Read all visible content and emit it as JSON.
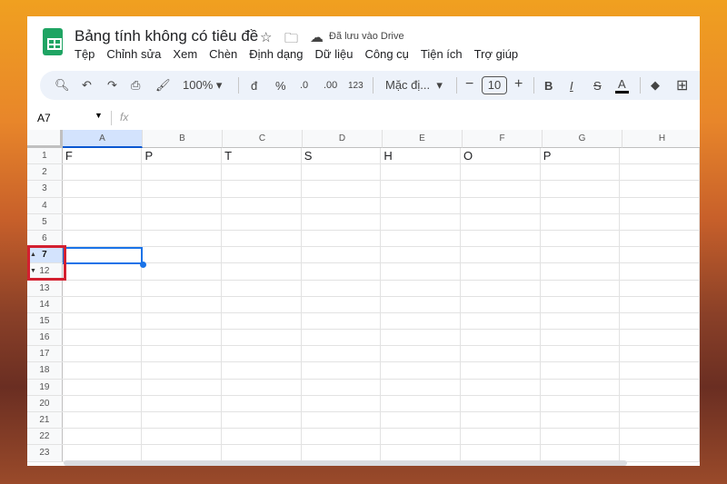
{
  "title": "Bảng tính không có tiêu đề",
  "save_status": "Đã lưu vào Drive",
  "menu": [
    "Tệp",
    "Chỉnh sửa",
    "Xem",
    "Chèn",
    "Định dạng",
    "Dữ liệu",
    "Công cụ",
    "Tiện ích",
    "Trợ giúp"
  ],
  "toolbar": {
    "zoom": "100%",
    "currency": "đ",
    "percent": "%",
    "dec_decrease": ".0",
    "dec_increase": ".00",
    "number_format": "123",
    "font": "Mặc đị...",
    "font_size": "10",
    "bold": "B",
    "italic": "I",
    "text_color": "A"
  },
  "name_box": "A7",
  "fx": "fx",
  "columns": [
    "A",
    "B",
    "C",
    "D",
    "E",
    "F",
    "G",
    "H"
  ],
  "rows": [
    {
      "n": "1",
      "cells": [
        "F",
        "P",
        "T",
        "S",
        "H",
        "O",
        "P",
        ""
      ]
    },
    {
      "n": "2",
      "cells": []
    },
    {
      "n": "3",
      "cells": []
    },
    {
      "n": "4",
      "cells": []
    },
    {
      "n": "5",
      "cells": []
    },
    {
      "n": "6",
      "cells": []
    },
    {
      "n": "7",
      "cells": []
    },
    {
      "n": "12",
      "cells": []
    },
    {
      "n": "13",
      "cells": []
    },
    {
      "n": "14",
      "cells": []
    },
    {
      "n": "15",
      "cells": []
    },
    {
      "n": "16",
      "cells": []
    },
    {
      "n": "17",
      "cells": []
    },
    {
      "n": "18",
      "cells": []
    },
    {
      "n": "19",
      "cells": []
    },
    {
      "n": "20",
      "cells": []
    },
    {
      "n": "21",
      "cells": []
    },
    {
      "n": "22",
      "cells": []
    },
    {
      "n": "23",
      "cells": []
    }
  ],
  "selected_cell": "A7"
}
